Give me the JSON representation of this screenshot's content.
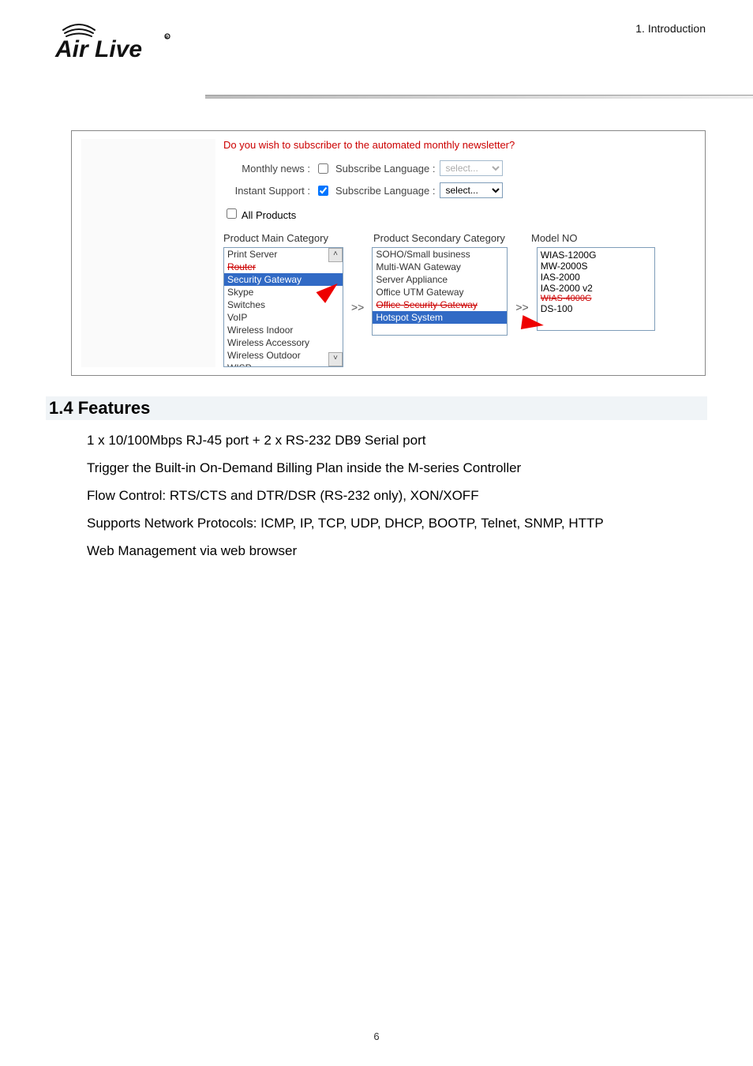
{
  "header": {
    "logo_text": "Air Live",
    "chapter_label": "1. Introduction"
  },
  "screenshot": {
    "newsletter_question": "Do you wish to subscriber to the automated monthly newsletter?",
    "rows": {
      "monthly_label": "Monthly news  :",
      "instant_label": "Instant Support  :",
      "subscribe_label": "Subscribe Language  :",
      "select_placeholder": "select..."
    },
    "monthly_checked": false,
    "instant_checked": true,
    "all_products_label": "All Products",
    "col_main": "Product Main Category",
    "col_secondary": "Product Secondary Category",
    "col_model": "Model NO",
    "main_list": [
      "Print Server",
      "Router",
      "Security Gateway",
      "Skype",
      "Switches",
      "VoIP",
      "Wireless Indoor",
      "Wireless Accessory",
      "Wireless Outdoor",
      "WISP"
    ],
    "main_selected_index": 2,
    "secondary_list": [
      "SOHO/Small business",
      "Multi-WAN Gateway",
      "Server Appliance",
      "Office UTM Gateway",
      "Office Security Gateway",
      "Hotspot System"
    ],
    "secondary_selected_index": 5,
    "model_list": [
      "WIAS-1200G",
      "MW-2000S",
      "IAS-2000",
      "IAS-2000 v2",
      "WIAS-4000G",
      "DS-100"
    ],
    "move_btn": ">>"
  },
  "section": {
    "title": "1.4 Features",
    "items": [
      "1 x 10/100Mbps RJ-45 port + 2 x RS-232 DB9 Serial port",
      "Trigger the Built-in On-Demand Billing Plan inside the M-series Controller",
      "Flow Control: RTS/CTS and DTR/DSR (RS-232 only), XON/XOFF",
      "Supports Network Protocols: ICMP, IP, TCP, UDP, DHCP, BOOTP, Telnet, SNMP, HTTP",
      "Web Management via web browser"
    ]
  },
  "page_number": "6"
}
